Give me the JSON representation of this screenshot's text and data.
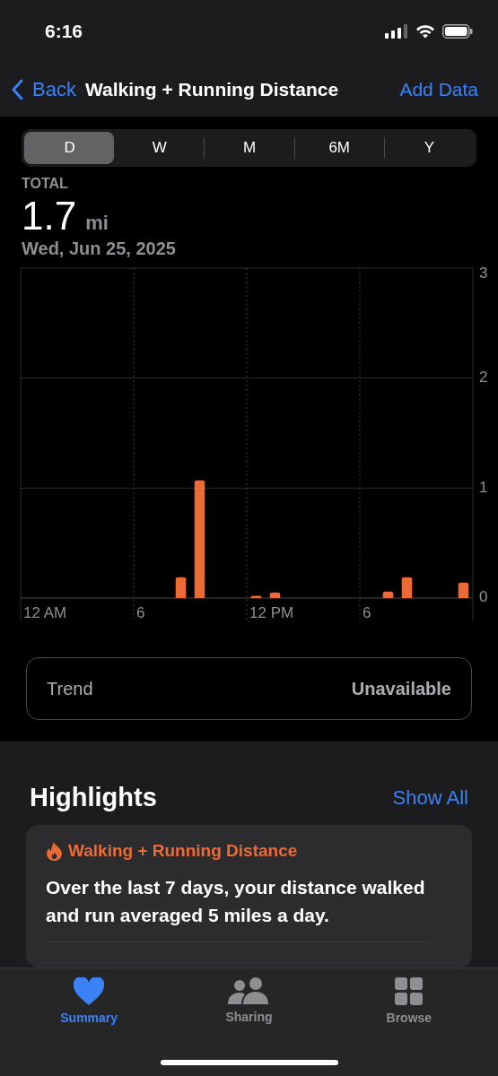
{
  "status_bar": {
    "time": "6:16"
  },
  "nav": {
    "back": "Back",
    "title": "Walking + Running Distance",
    "action": "Add Data"
  },
  "segments": [
    {
      "label": "D",
      "selected": true
    },
    {
      "label": "W",
      "selected": false
    },
    {
      "label": "M",
      "selected": false
    },
    {
      "label": "6M",
      "selected": false
    },
    {
      "label": "Y",
      "selected": false
    }
  ],
  "summary": {
    "label": "TOTAL",
    "value": "1.7",
    "unit": "mi",
    "date": "Wed, Jun 25, 2025"
  },
  "chart": {
    "x_axis_labels": [
      "12 AM",
      "6",
      "12 PM",
      "6"
    ],
    "chart_data": {
      "type": "bar",
      "series": [
        {
          "color": "#ec6a36",
          "values": [
            null,
            null,
            null,
            null,
            null,
            null,
            null,
            null,
            0.19,
            1.07,
            null,
            null,
            0.02,
            0.05,
            null,
            null,
            null,
            null,
            null,
            0.06,
            0.19,
            null,
            null,
            0.14
          ]
        }
      ],
      "ylim": [
        0,
        3
      ],
      "yticks": [
        0,
        1,
        2,
        3
      ]
    }
  },
  "trend": {
    "label": "Trend",
    "value": "Unavailable"
  },
  "highlights": {
    "title": "Highlights",
    "action": "Show All",
    "cards": [
      {
        "category": "Walking + Running Distance",
        "text": "Over the last 7 days, your distance walked and run averaged 5 miles a day."
      }
    ]
  },
  "tab_bar": [
    {
      "label": "Summary",
      "selected": true
    },
    {
      "label": "Sharing",
      "selected": false
    },
    {
      "label": "Browse",
      "selected": false
    }
  ]
}
